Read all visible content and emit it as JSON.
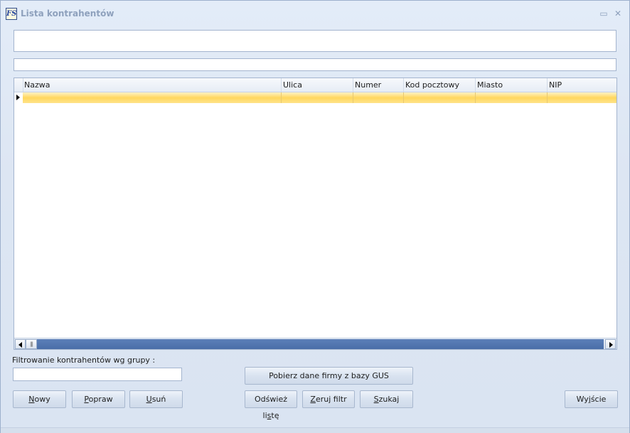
{
  "window": {
    "title": "Lista kontrahentów",
    "icon_text": "FS",
    "minimize_glyph": "▭",
    "close_glyph": "✕"
  },
  "grid": {
    "columns": [
      "Nazwa",
      "Ulica",
      "Numer",
      "Kod pocztowy",
      "Miasto",
      "NIP"
    ],
    "scroll_thumb_glyph": "|||"
  },
  "filter": {
    "label": "Filtrowanie kontrahentów wg grupy :",
    "value": ""
  },
  "buttons": {
    "new": {
      "pre": "",
      "key": "N",
      "post": "owy"
    },
    "edit": {
      "pre": "",
      "key": "P",
      "post": "opraw"
    },
    "delete": {
      "pre": "",
      "key": "U",
      "post": "suń"
    },
    "gus": "Pobierz dane firmy z bazy GUS",
    "refresh": {
      "pre": "Odśwież li",
      "key": "s",
      "post": "tę"
    },
    "reset_filter": {
      "pre": "",
      "key": "Z",
      "post": "eruj filtr"
    },
    "search": {
      "pre": "",
      "key": "S",
      "post": "zukaj"
    },
    "exit": {
      "pre": "Wy",
      "key": "j",
      "post": "ście"
    }
  },
  "colors": {
    "selected_row": "#ffd75e",
    "scrollbar": "#5c7fb8",
    "window_bg": "#dfe8f5"
  }
}
